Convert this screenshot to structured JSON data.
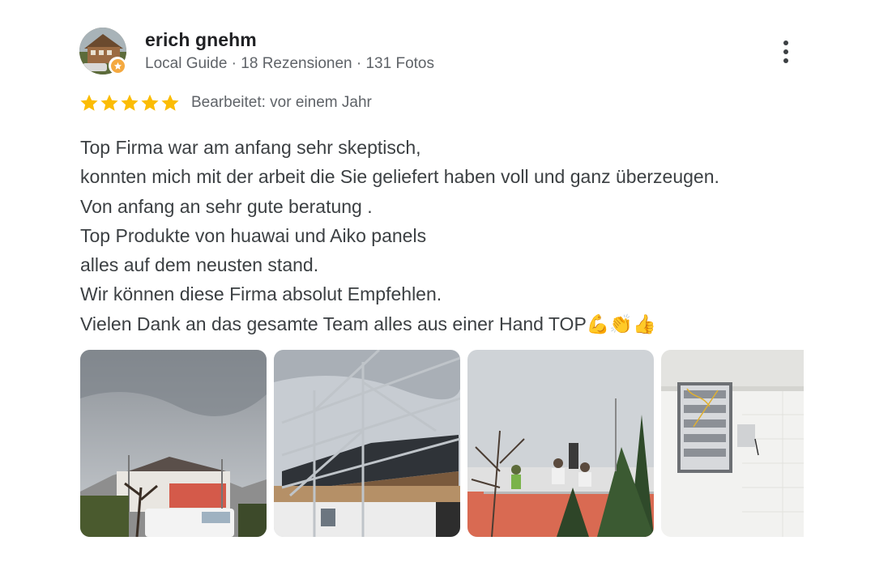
{
  "reviewer": {
    "name": "erich gnehm",
    "meta": "Local Guide · 18 Rezensionen · 131 Fotos",
    "avatar_icon": "house-photo",
    "badge_icon": "local-guide-star-icon",
    "badge_color": "#f4a940"
  },
  "rating": {
    "stars": 5,
    "star_color": "#fbbc04",
    "edited_label": "Bearbeitet: vor einem Jahr"
  },
  "review": {
    "lines": [
      "Top Firma war am anfang sehr skeptisch,",
      "konnten mich mit der arbeit die Sie geliefert haben voll und ganz überzeugen.",
      "Von anfang an sehr gute beratung .",
      "Top Produkte von huawai und Aiko panels",
      "alles auf dem neusten stand.",
      "Wir können diese Firma absolut Empfehlen.",
      "Vielen Dank an das gesamte Team alles aus einer Hand TOP💪👏👍"
    ]
  },
  "menu": {
    "icon": "more-vert-icon"
  },
  "photos": [
    {
      "subject": "house-with-scaffolding-and-van"
    },
    {
      "subject": "solar-panel-mounting-frame"
    },
    {
      "subject": "workers-on-roof"
    },
    {
      "subject": "electrical-distribution-cabinet"
    }
  ]
}
